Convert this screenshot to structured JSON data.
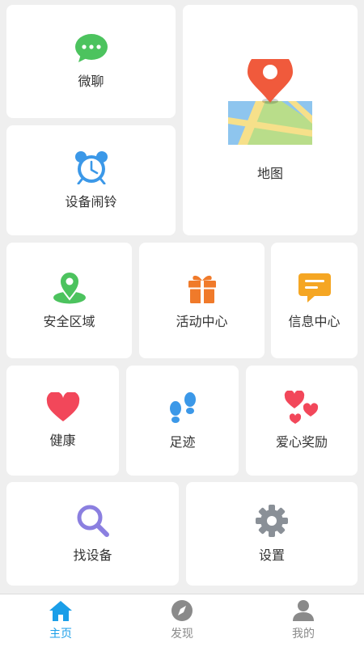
{
  "tiles": {
    "chat": {
      "label": "微聊",
      "icon": "chat-bubble-icon",
      "color": "#4cc35e"
    },
    "map": {
      "label": "地图",
      "icon": "map-pin-icon",
      "color": "#f05a3c"
    },
    "alarm": {
      "label": "设备闹铃",
      "icon": "alarm-clock-icon",
      "color": "#3b98e8"
    },
    "safe_zone": {
      "label": "安全区域",
      "icon": "location-pin-icon",
      "color": "#4cc35e"
    },
    "activity": {
      "label": "活动中心",
      "icon": "gift-icon",
      "color": "#f07a2a"
    },
    "messages": {
      "label": "信息中心",
      "icon": "message-icon",
      "color": "#f5a623"
    },
    "health": {
      "label": "健康",
      "icon": "heart-icon",
      "color": "#f2475a"
    },
    "footprint": {
      "label": "足迹",
      "icon": "footprints-icon",
      "color": "#3b98e8"
    },
    "love_reward": {
      "label": "爱心奖励",
      "icon": "hearts-icon",
      "color": "#f2475a"
    },
    "find_device": {
      "label": "找设备",
      "icon": "magnifier-icon",
      "color": "#8b7fe0"
    },
    "settings": {
      "label": "设置",
      "icon": "gear-icon",
      "color": "#8a9097"
    }
  },
  "tabbar": {
    "active_color": "#1a9ee8",
    "inactive_color": "#8a8a8a",
    "items": [
      {
        "label": "主页",
        "icon": "home-icon",
        "active": true
      },
      {
        "label": "发现",
        "icon": "compass-icon",
        "active": false
      },
      {
        "label": "我的",
        "icon": "person-icon",
        "active": false
      }
    ]
  }
}
